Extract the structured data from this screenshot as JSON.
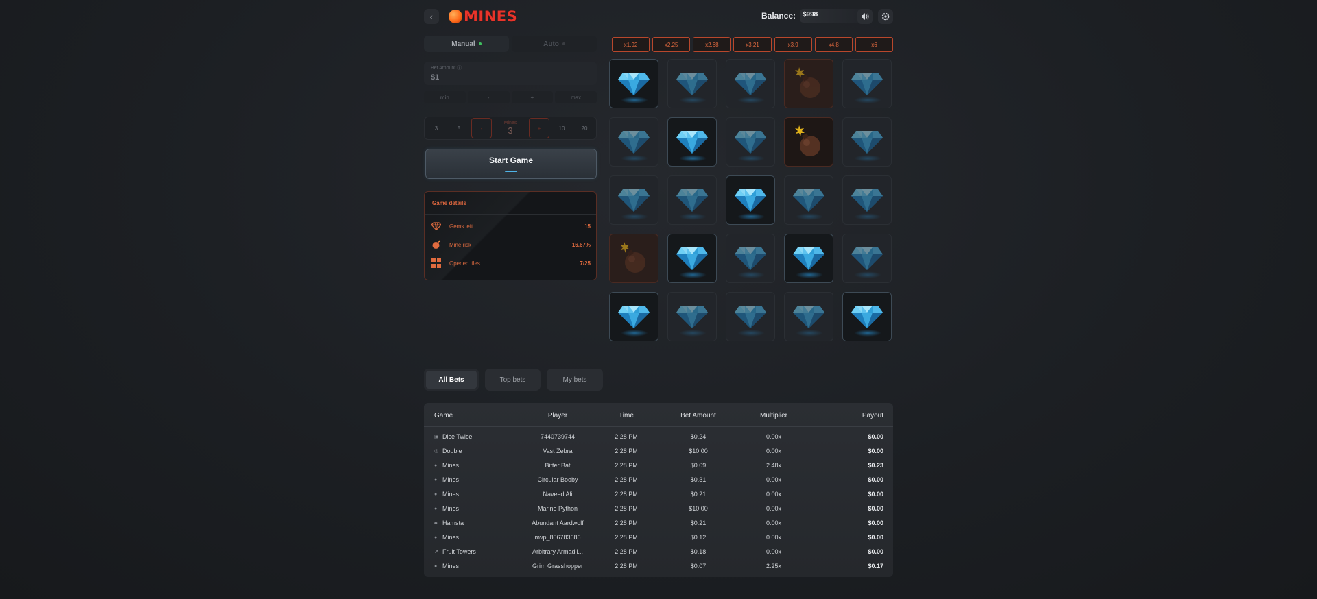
{
  "header": {
    "logo_text": "MINES",
    "balance_label": "Balance:",
    "balance_value": "$998"
  },
  "mode_tabs": [
    {
      "label": "Manual",
      "active": true,
      "dot_color": "#3fbf5f"
    },
    {
      "label": "Auto",
      "active": false,
      "dot_color": "#3a3d42"
    }
  ],
  "bet": {
    "label": "Bet Amount",
    "value": "$1",
    "buttons": [
      "min",
      "-",
      "+",
      "max"
    ]
  },
  "mines": {
    "options_left": [
      "3",
      "5"
    ],
    "dec_label": "-",
    "label": "Mines",
    "value": "3",
    "inc_label": "+",
    "options_right": [
      "10",
      "20"
    ]
  },
  "start_button": "Start Game",
  "game_details": {
    "title": "Game details",
    "rows": [
      {
        "label": "Gems left",
        "value": "15",
        "icon": "gem-outline-icon"
      },
      {
        "label": "Mine risk",
        "value": "16.67%",
        "icon": "bomb-icon"
      },
      {
        "label": "Opened tiles",
        "value": "7/25",
        "icon": "grid-icon"
      }
    ]
  },
  "multipliers": [
    "x1.92",
    "x2.25",
    "x2.68",
    "x3.21",
    "x3.9",
    "x4.8",
    "x6"
  ],
  "grid": [
    [
      "gem-revealed",
      "gem",
      "gem",
      "mine",
      "gem"
    ],
    [
      "gem",
      "gem-revealed",
      "gem",
      "mine-revealed",
      "gem"
    ],
    [
      "gem",
      "gem",
      "gem-revealed",
      "gem",
      "gem"
    ],
    [
      "mine",
      "gem-revealed",
      "gem",
      "gem-revealed",
      "gem"
    ],
    [
      "gem-revealed",
      "gem",
      "gem",
      "gem",
      "gem-revealed"
    ]
  ],
  "bets_tabs": [
    "All Bets",
    "Top bets",
    "My bets"
  ],
  "table": {
    "headers": {
      "game": "Game",
      "player": "Player",
      "time": "Time",
      "bet": "Bet Amount",
      "multiplier": "Multiplier",
      "payout": "Payout"
    },
    "rows": [
      {
        "game": "Dice Twice",
        "icon": "dice-icon",
        "player": "7440739744",
        "time": "2:28 PM",
        "bet": "$0.24",
        "multiplier": "0.00x",
        "payout": "$0.00"
      },
      {
        "game": "Double",
        "icon": "double-icon",
        "player": "Vast Zebra",
        "time": "2:28 PM",
        "bet": "$10.00",
        "multiplier": "0.00x",
        "payout": "$0.00"
      },
      {
        "game": "Mines",
        "icon": "mines-icon",
        "player": "Bitter Bat",
        "time": "2:28 PM",
        "bet": "$0.09",
        "multiplier": "2.48x",
        "payout": "$0.23"
      },
      {
        "game": "Mines",
        "icon": "mines-icon",
        "player": "Circular Booby",
        "time": "2:28 PM",
        "bet": "$0.31",
        "multiplier": "0.00x",
        "payout": "$0.00"
      },
      {
        "game": "Mines",
        "icon": "mines-icon",
        "player": "Naveed Ali",
        "time": "2:28 PM",
        "bet": "$0.21",
        "multiplier": "0.00x",
        "payout": "$0.00"
      },
      {
        "game": "Mines",
        "icon": "mines-icon",
        "player": "Marine Python",
        "time": "2:28 PM",
        "bet": "$10.00",
        "multiplier": "0.00x",
        "payout": "$0.00"
      },
      {
        "game": "Hamsta",
        "icon": "hamsta-icon",
        "player": "Abundant Aardwolf",
        "time": "2:28 PM",
        "bet": "$0.21",
        "multiplier": "0.00x",
        "payout": "$0.00"
      },
      {
        "game": "Mines",
        "icon": "mines-icon",
        "player": "mvp_806783686",
        "time": "2:28 PM",
        "bet": "$0.12",
        "multiplier": "0.00x",
        "payout": "$0.00"
      },
      {
        "game": "Fruit Towers",
        "icon": "fruit-towers-icon",
        "player": "Arbitrary Armadil...",
        "time": "2:28 PM",
        "bet": "$0.18",
        "multiplier": "0.00x",
        "payout": "$0.00"
      },
      {
        "game": "Mines",
        "icon": "mines-icon",
        "player": "Grim Grasshopper",
        "time": "2:28 PM",
        "bet": "$0.07",
        "multiplier": "2.25x",
        "payout": "$0.17"
      }
    ]
  }
}
